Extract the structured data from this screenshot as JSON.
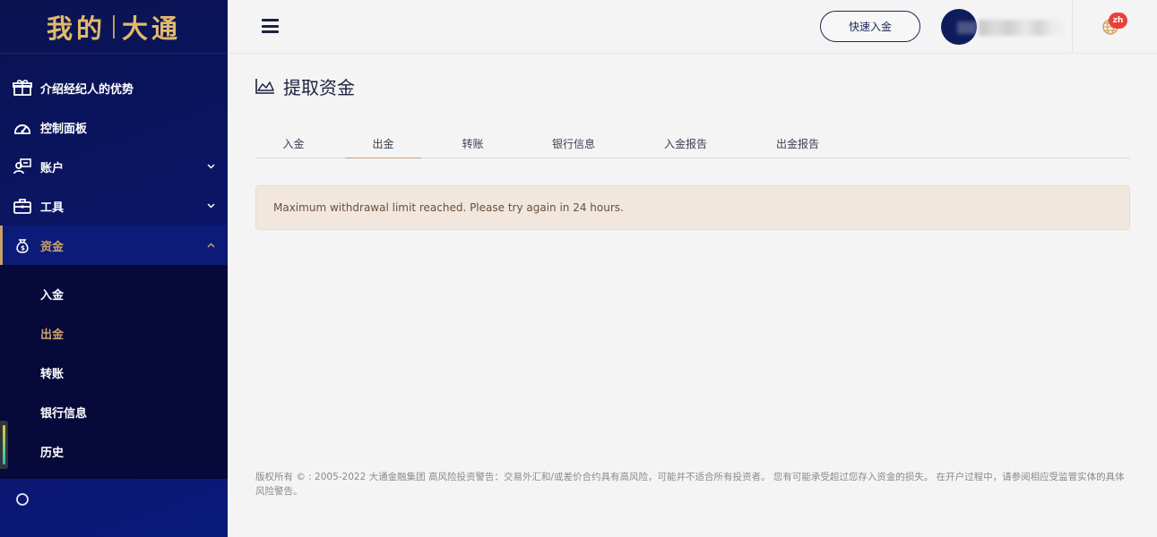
{
  "brand": {
    "part1": "我的",
    "part2": "大通"
  },
  "sidebar": {
    "items": [
      {
        "label": "介绍经纪人的优势",
        "icon": "gift-icon"
      },
      {
        "label": "控制面板",
        "icon": "dashboard-icon"
      },
      {
        "label": "账户",
        "icon": "account-icon",
        "chevron": "down"
      },
      {
        "label": "工具",
        "icon": "briefcase-icon",
        "chevron": "down"
      },
      {
        "label": "资金",
        "icon": "money-bag-icon",
        "chevron": "up",
        "active": true
      }
    ],
    "sub_items": [
      {
        "label": "入金"
      },
      {
        "label": "出金",
        "active": true
      },
      {
        "label": "转账"
      },
      {
        "label": "银行信息"
      },
      {
        "label": "历史"
      }
    ]
  },
  "header": {
    "quick_deposit_label": "快速入金",
    "language_badge": "zh"
  },
  "main": {
    "title": "提取资金",
    "tabs": [
      {
        "label": "入金"
      },
      {
        "label": "出金",
        "active": true
      },
      {
        "label": "转账"
      },
      {
        "label": "银行信息"
      },
      {
        "label": "入金报告"
      },
      {
        "label": "出金报告"
      }
    ],
    "alert_message": "Maximum withdrawal limit reached. Please try again in 24 hours.",
    "footer_text": "版权所有 © : 2005-2022 大通金融集团 高风险投资警告：交易外汇和/或差价合约具有高风险，可能并不适合所有投资者。 您有可能承受超过您存入资金的损失。 在开户过程中，请参阅相应受监管实体的具体风险警告。"
  },
  "colors": {
    "sidebar_bg": "#0b1566",
    "accent_gold": "#c9a36d",
    "alert_bg": "#f1e7dc",
    "badge_red": "#e8413a"
  }
}
